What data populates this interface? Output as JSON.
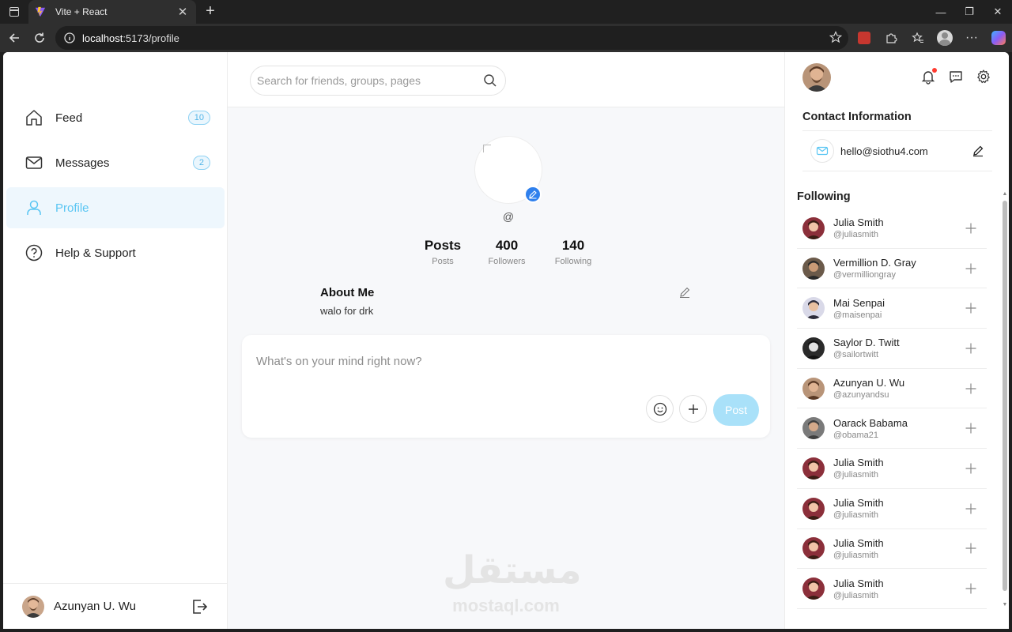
{
  "browser": {
    "tab_title": "Vite + React",
    "url_host": "localhost",
    "url_rest": ":5173/profile"
  },
  "sidebar": {
    "items": [
      {
        "label": "Feed",
        "badge": "10",
        "icon": "home-icon"
      },
      {
        "label": "Messages",
        "badge": "2",
        "icon": "mail-icon"
      },
      {
        "label": "Profile",
        "badge": "",
        "icon": "user-icon",
        "active": true
      },
      {
        "label": "Help & Support",
        "badge": "",
        "icon": "help-icon"
      }
    ],
    "user_name": "Azunyan U. Wu"
  },
  "search": {
    "placeholder": "Search for friends, groups, pages"
  },
  "profile": {
    "handle": "@",
    "stats": [
      {
        "value": "Posts",
        "label": "Posts"
      },
      {
        "value": "400",
        "label": "Followers"
      },
      {
        "value": "140",
        "label": "Following"
      }
    ],
    "about_title": "About Me",
    "about_text": "walo for drk"
  },
  "composer": {
    "placeholder": "What's on your mind right now?",
    "post_label": "Post"
  },
  "watermark": {
    "arabic": "مستقل",
    "latin": "mostaql.com"
  },
  "right_panel": {
    "contact_title": "Contact Information",
    "email": "hello@siothu4.com",
    "following_title": "Following",
    "following": [
      {
        "name": "Julia Smith",
        "handle": "@juliasmith"
      },
      {
        "name": "Vermillion D. Gray",
        "handle": "@vermilliongray"
      },
      {
        "name": "Mai Senpai",
        "handle": "@maisenpai"
      },
      {
        "name": "Saylor D. Twitt",
        "handle": "@sailortwitt"
      },
      {
        "name": "Azunyan U. Wu",
        "handle": "@azunyandsu"
      },
      {
        "name": "Oarack Babama",
        "handle": "@obama21"
      },
      {
        "name": "Julia Smith",
        "handle": "@juliasmith"
      },
      {
        "name": "Julia Smith",
        "handle": "@juliasmith"
      },
      {
        "name": "Julia Smith",
        "handle": "@juliasmith"
      },
      {
        "name": "Julia Smith",
        "handle": "@juliasmith"
      }
    ]
  },
  "colors": {
    "accent": "#5ac6f3",
    "active_bg": "#eef7fd",
    "post_button": "#a9e1f9",
    "edit_badge": "#2f80ed"
  }
}
